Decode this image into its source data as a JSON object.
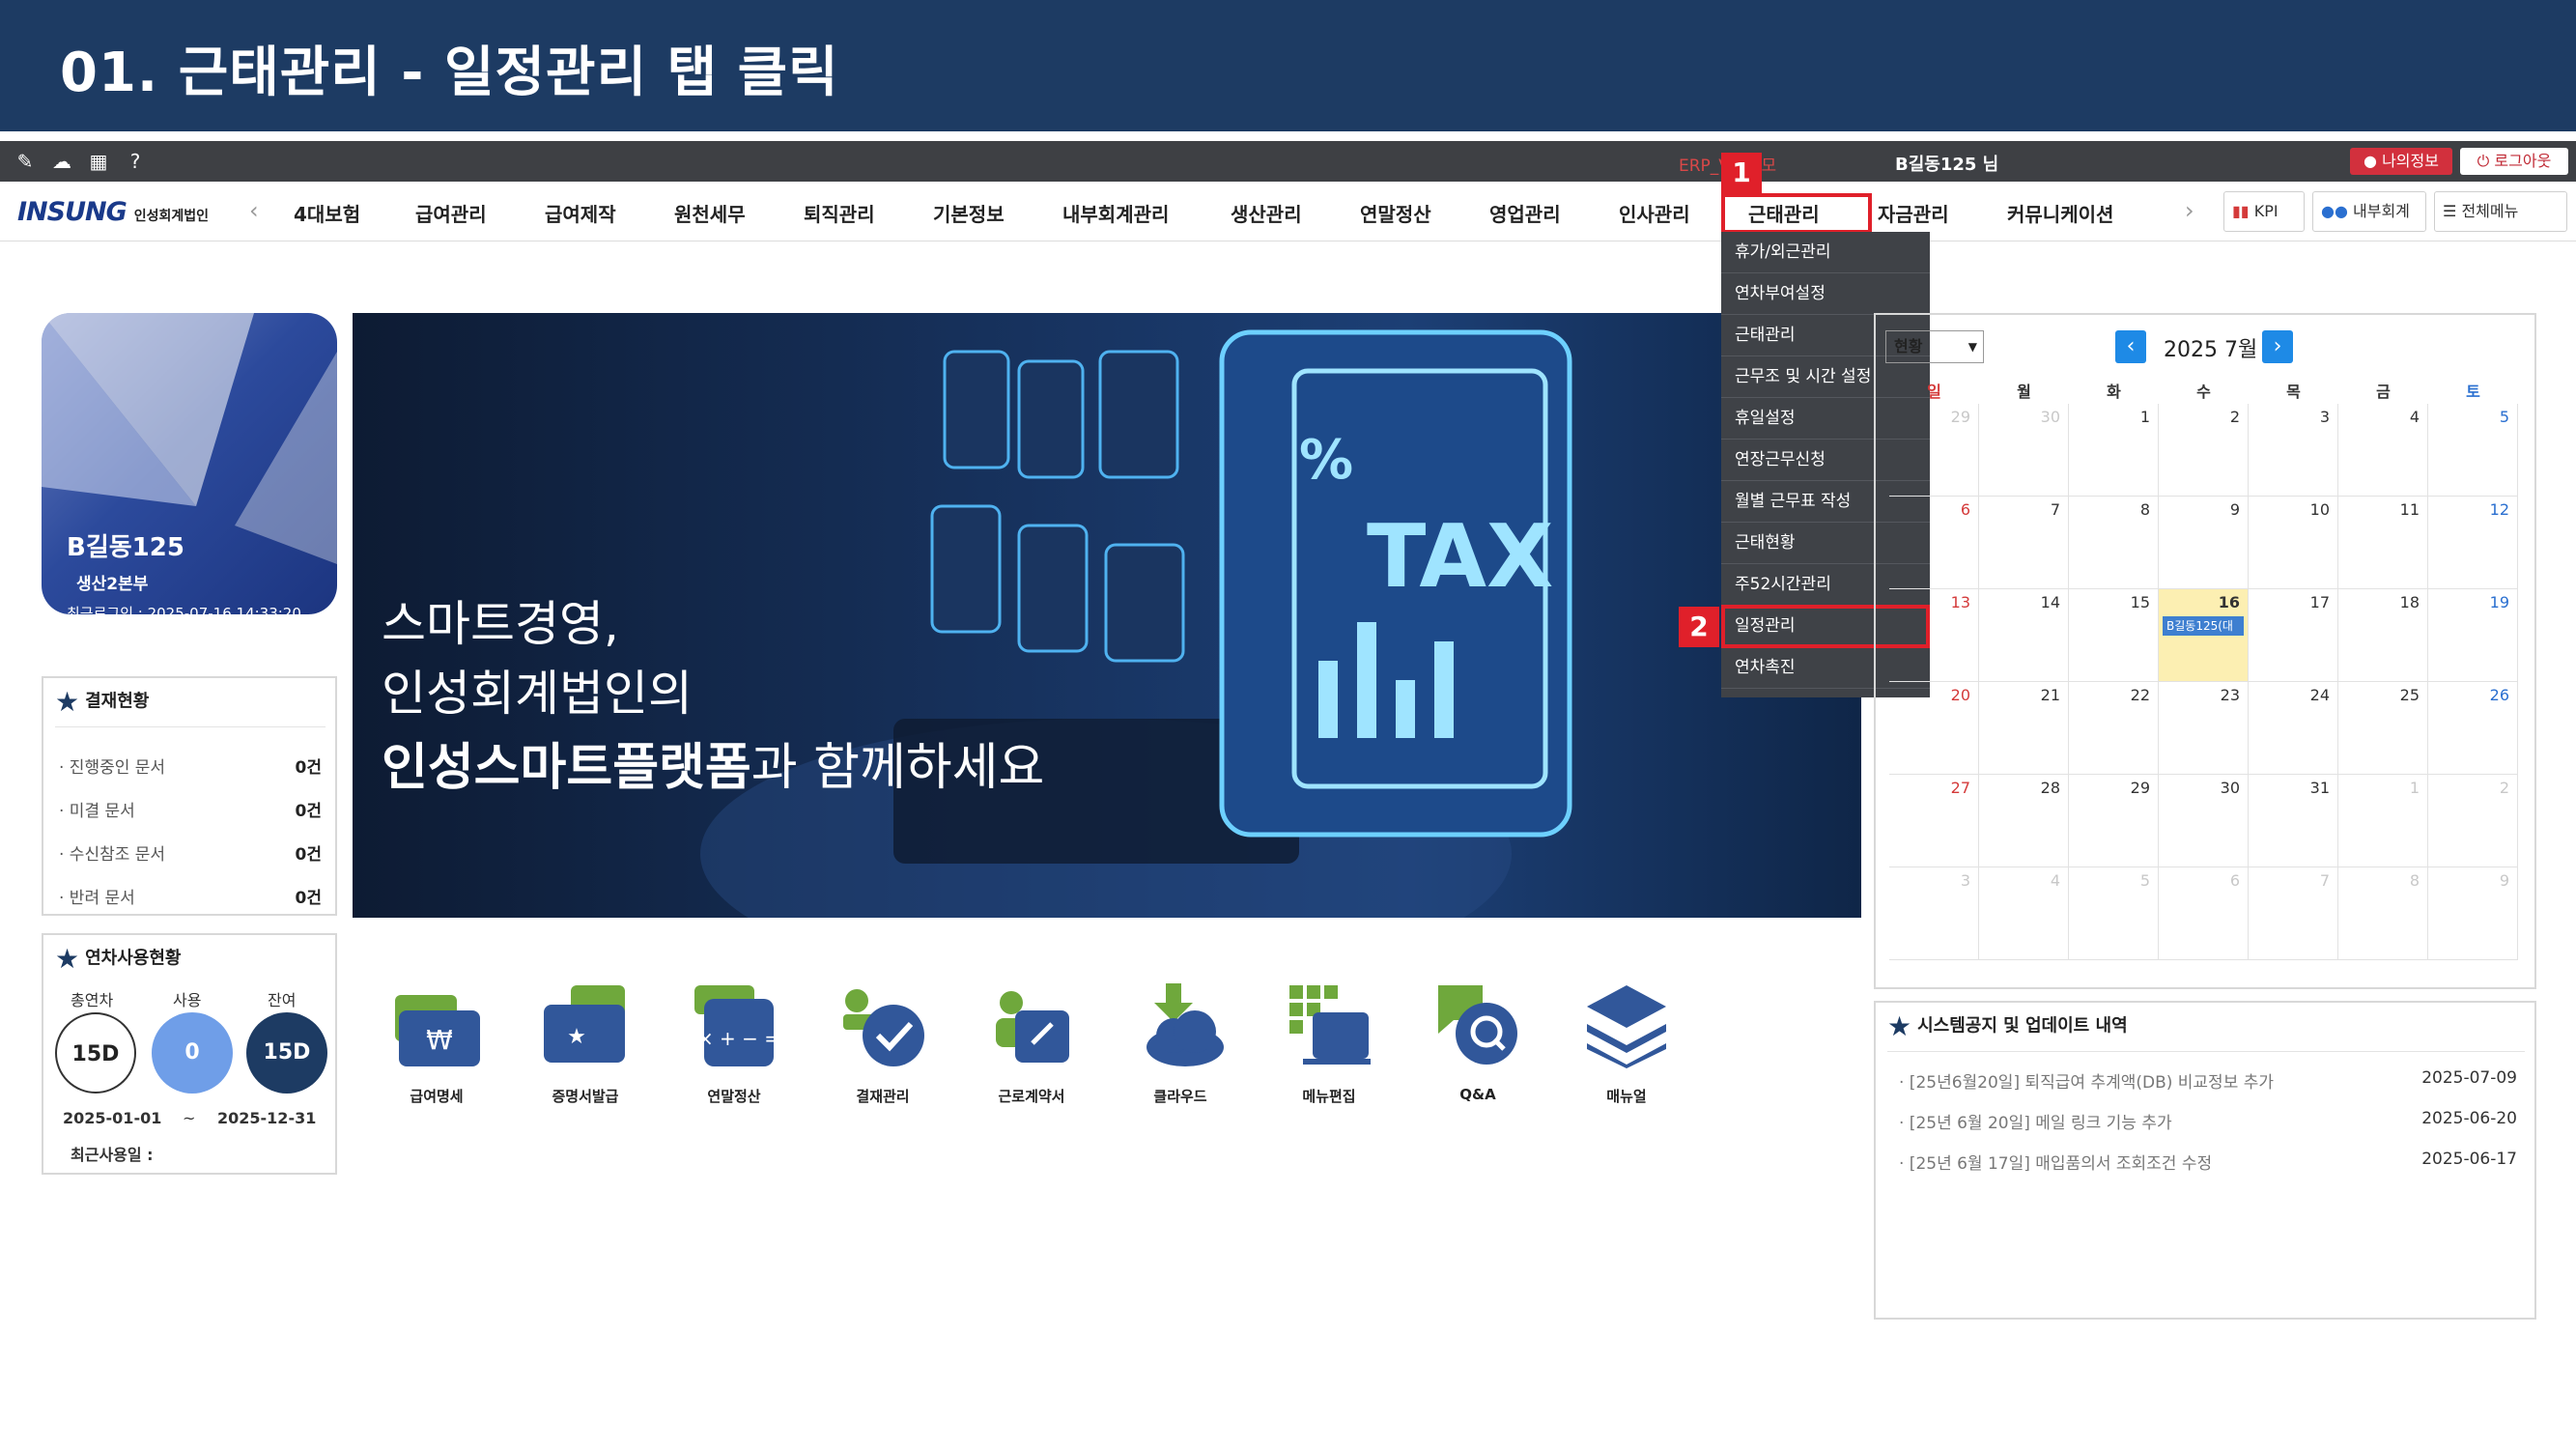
{
  "slide": {
    "title": "01. 근태관리 - 일정관리 탭 클릭"
  },
  "topbar": {
    "erp_label": "ERP_VIEW모",
    "user_label": "B길동125 님",
    "myinfo_label": "나의정보",
    "logout_label": "로그아웃"
  },
  "logo": {
    "main": "INSUNG",
    "sub": "인성회계법인"
  },
  "nav": {
    "items": [
      "4대보험",
      "급여관리",
      "급여제작",
      "원천세무",
      "퇴직관리",
      "기본정보",
      "내부회계관리",
      "생산관리",
      "연말정산",
      "영업관리",
      "인사관리",
      "근태관리",
      "자금관리",
      "커뮤니케이션"
    ],
    "kpi_label": "KPI",
    "internal_label": "내부회계",
    "allmenu_label": "전체메뉴"
  },
  "markers": {
    "step1": "1",
    "step2": "2"
  },
  "dropdown": {
    "items": [
      "휴가/외근관리",
      "연차부여설정",
      "근태관리",
      "근무조 및 시간 설정",
      "휴일설정",
      "연장근무신청",
      "월별 근무표 작성",
      "근태현황",
      "주52시간관리",
      "일정관리",
      "연차촉진"
    ]
  },
  "profile": {
    "name": "B길동125",
    "dept": "생산2본부",
    "last_login": "최근로그인 : 2025-07-16 14:33:20"
  },
  "approval": {
    "title": "결재현황",
    "rows": [
      {
        "label": "· 진행중인 문서",
        "count": "0건"
      },
      {
        "label": "· 미결 문서",
        "count": "0건"
      },
      {
        "label": "· 수신참조 문서",
        "count": "0건"
      },
      {
        "label": "· 반려 문서",
        "count": "0건"
      }
    ]
  },
  "leave": {
    "title": "연차사용현황",
    "total_label": "총연차",
    "used_label": "사용",
    "remain_label": "잔여",
    "total": "15D",
    "used": "0",
    "remain": "15D",
    "start": "2025-01-01",
    "tilde": "~",
    "end": "2025-12-31",
    "recent": "최근사용일 :"
  },
  "banner": {
    "line1": "스마트경영,",
    "line2": "인성회계법인의",
    "line3a": "인성스마트플랫폼",
    "line3b": "과 함께하세요",
    "tax_label": "TAX",
    "percent": "%"
  },
  "quick_links": [
    "급여명세",
    "증명서발급",
    "연말정산",
    "결재관리",
    "근로계약서",
    "클라우드",
    "메뉴편집",
    "Q&A",
    "매뉴얼"
  ],
  "calendar": {
    "select_value": "현황",
    "month_label": "2025 7월",
    "prev": "‹",
    "next": "›",
    "dow": [
      "일",
      "월",
      "화",
      "수",
      "목",
      "금",
      "토"
    ],
    "weeks": [
      [
        "29",
        "30",
        "1",
        "2",
        "3",
        "4",
        "5"
      ],
      [
        "6",
        "7",
        "8",
        "9",
        "10",
        "11",
        "12"
      ],
      [
        "13",
        "14",
        "15",
        "16",
        "17",
        "18",
        "19"
      ],
      [
        "20",
        "21",
        "22",
        "23",
        "24",
        "25",
        "26"
      ],
      [
        "27",
        "28",
        "29",
        "30",
        "31",
        "1",
        "2"
      ],
      [
        "3",
        "4",
        "5",
        "6",
        "7",
        "8",
        "9"
      ]
    ],
    "event_label": "B길동125(대"
  },
  "notice": {
    "title": "시스템공지 및 업데이트 내역",
    "rows": [
      {
        "text": "· [25년6월20일] 퇴직급여 추계액(DB) 비교정보 추가",
        "date": "2025-07-09"
      },
      {
        "text": "· [25년 6월 20일] 메일 링크 기능 추가",
        "date": "2025-06-20"
      },
      {
        "text": "· [25년 6월 17일] 매입품의서 조회조건 수정",
        "date": "2025-06-17"
      }
    ]
  },
  "colors": {
    "header_bg": "#1d3b63",
    "highlight": "#e0202a",
    "topbar": "#3e4044",
    "accent_blue": "#1e8ae6"
  }
}
